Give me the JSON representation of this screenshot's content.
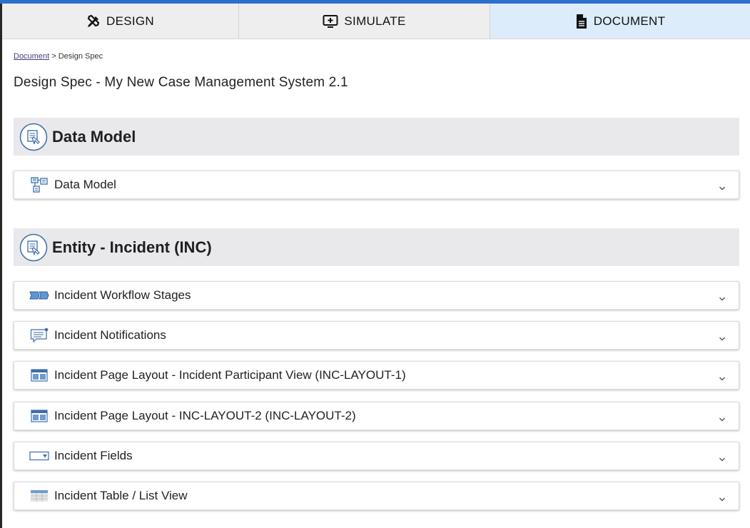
{
  "tabs": [
    {
      "label": "DESIGN",
      "icon": "design-tools-icon",
      "active": false
    },
    {
      "label": "SIMULATE",
      "icon": "simulate-monitor-icon",
      "active": false
    },
    {
      "label": "DOCUMENT",
      "icon": "document-icon",
      "active": true
    }
  ],
  "breadcrumb": {
    "link": "Document",
    "separator": ">",
    "current": "Design Spec"
  },
  "page_title": "Design Spec - My New Case Management System 2.1",
  "sections": [
    {
      "title": "Data Model",
      "icon": "spec-document-icon",
      "items": [
        {
          "label": "Data Model",
          "icon": "data-model-icon"
        }
      ]
    },
    {
      "title": "Entity - Incident (INC)",
      "icon": "spec-document-icon",
      "items": [
        {
          "label": "Incident Workflow Stages",
          "icon": "workflow-stages-icon"
        },
        {
          "label": "Incident Notifications",
          "icon": "notification-icon"
        },
        {
          "label": "Incident Page Layout - Incident Participant View (INC-LAYOUT-1)",
          "icon": "page-layout-icon"
        },
        {
          "label": "Incident Page Layout - INC-LAYOUT-2 (INC-LAYOUT-2)",
          "icon": "page-layout-icon"
        },
        {
          "label": "Incident Fields",
          "icon": "field-dropdown-icon"
        },
        {
          "label": "Incident Table / List View",
          "icon": "table-view-icon"
        }
      ]
    }
  ],
  "colors": {
    "accent": "#2d6fcf",
    "active_tab": "#dcecfa",
    "section_bg": "#e9e9ec",
    "icon_blue": "#3d6ea8"
  }
}
